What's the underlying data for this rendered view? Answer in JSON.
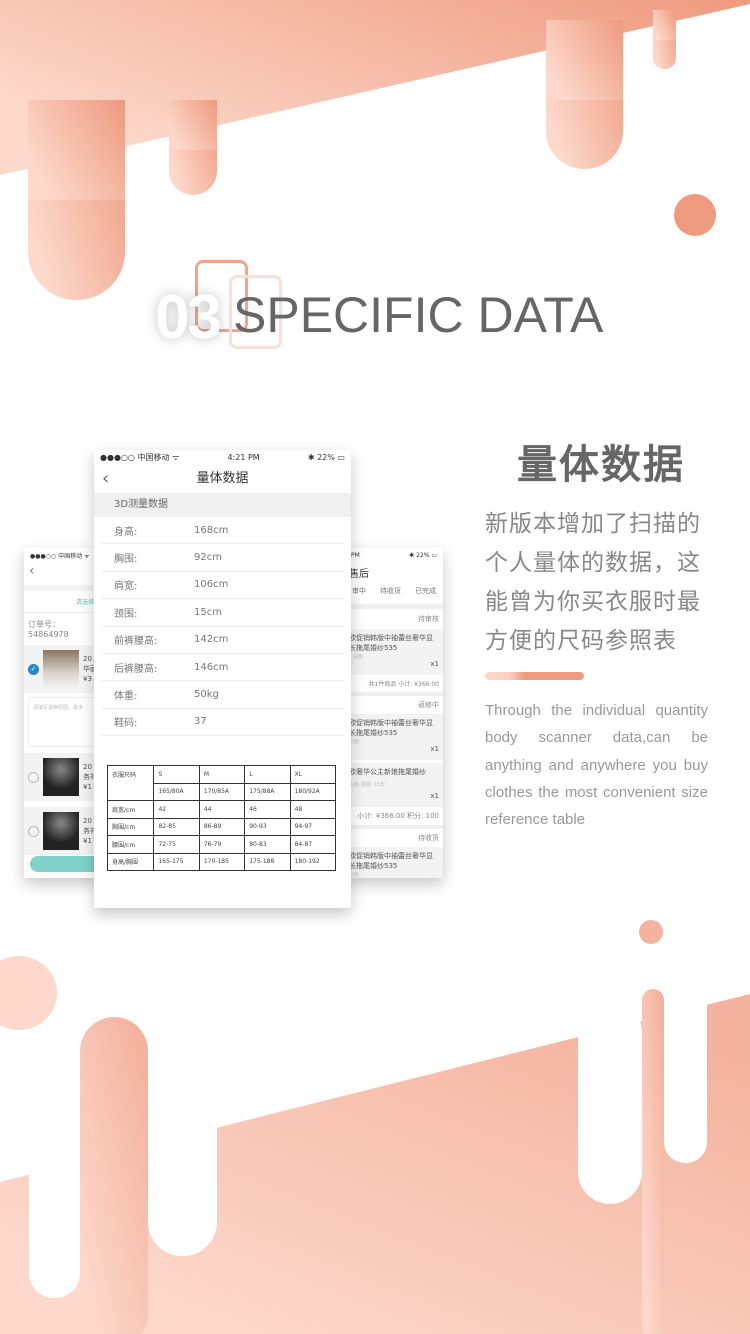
{
  "colors": {
    "accent": "#ee9a7e",
    "light": "#fcd9cc",
    "teal": "#55c8c0",
    "text": "#666666"
  },
  "header": {
    "number": "03",
    "title": "SPECIFIC DATA"
  },
  "feature": {
    "title": "量体数据",
    "description_cn": "新版本增加了扫描的个人量体的数据，这能曾为你买衣服时最方便的尺码参照表",
    "description_en": "Through the individual quantity body scanner data,can be anything and anywhere you buy clothes the most convenient size reference table"
  },
  "main_phone": {
    "status": {
      "carrier": "●●●○○ 中国移动 ᯤ",
      "time": "4:21 PM",
      "battery": "✱ 22% ▭"
    },
    "nav_title": "量体数据",
    "section": "3D测量数据",
    "rows": [
      {
        "label": "身高:",
        "value": "168cm"
      },
      {
        "label": "胸围:",
        "value": "92cm"
      },
      {
        "label": "肩宽:",
        "value": "106cm"
      },
      {
        "label": "颈围:",
        "value": "15cm"
      },
      {
        "label": "前裤腰高:",
        "value": "142cm"
      },
      {
        "label": "后裤腰高:",
        "value": "146cm"
      },
      {
        "label": "体重:",
        "value": "50kg"
      },
      {
        "label": "鞋码:",
        "value": "37"
      }
    ],
    "size_table": {
      "header": [
        "衣服尺码",
        "S",
        "M",
        "L",
        "XL"
      ],
      "sub": [
        "165/80A",
        "170/85A",
        "175/88A",
        "180/92A"
      ],
      "rows": [
        [
          "肩宽/cm",
          "42",
          "44",
          "46",
          "48"
        ],
        [
          "胸围/cm",
          "82-85",
          "86-89",
          "90-93",
          "94-97"
        ],
        [
          "腰围/cm",
          "72-75",
          "76-79",
          "80-83",
          "84-87"
        ],
        [
          "身高/胸围",
          "165-175",
          "170-185",
          "175-188",
          "180-192"
        ]
      ]
    }
  },
  "left_phone": {
    "status": "●●●○○ 中国移动 ᯤ",
    "hint": "请选择退",
    "order": "订单号：54864978",
    "items": [
      {
        "title": "20",
        "title2": "华丽",
        "price": "¥3"
      },
      {
        "title": "20",
        "title2": "务礼",
        "price": "¥1"
      },
      {
        "title": "20",
        "title2": "务礼",
        "price": "¥1"
      }
    ],
    "note_placeholder": "请填写退换原因，最多"
  },
  "right_phone": {
    "status_time": "PM",
    "status_battery": "✱ 22% ▭",
    "nav_title": "售后",
    "tabs": [
      "审中",
      "待收货",
      "已完成"
    ],
    "orders": [
      {
        "status": "待审核",
        "title": "欧促销韩版中袖蕾丝奢华显长拖尾婚纱535",
        "spec": "白色",
        "qty": "x1",
        "summary": "共1件商品  小计: ¥366.00"
      },
      {
        "status": "返修中",
        "title": "欧促销韩版中袖蕾丝奢华显长拖尾婚纱535",
        "spec": "白色",
        "qty": "x1"
      },
      {
        "status": "",
        "title": "欧奢华公主新娘拖尾婚纱",
        "spec": "白色,周期: 15天",
        "qty": "x1",
        "summary": "小计: ¥366.00 积分: 100"
      },
      {
        "status": "待收货",
        "title": "欧促销韩版中袖蕾丝奢华显长拖尾婚纱535",
        "spec": "白色"
      }
    ]
  }
}
